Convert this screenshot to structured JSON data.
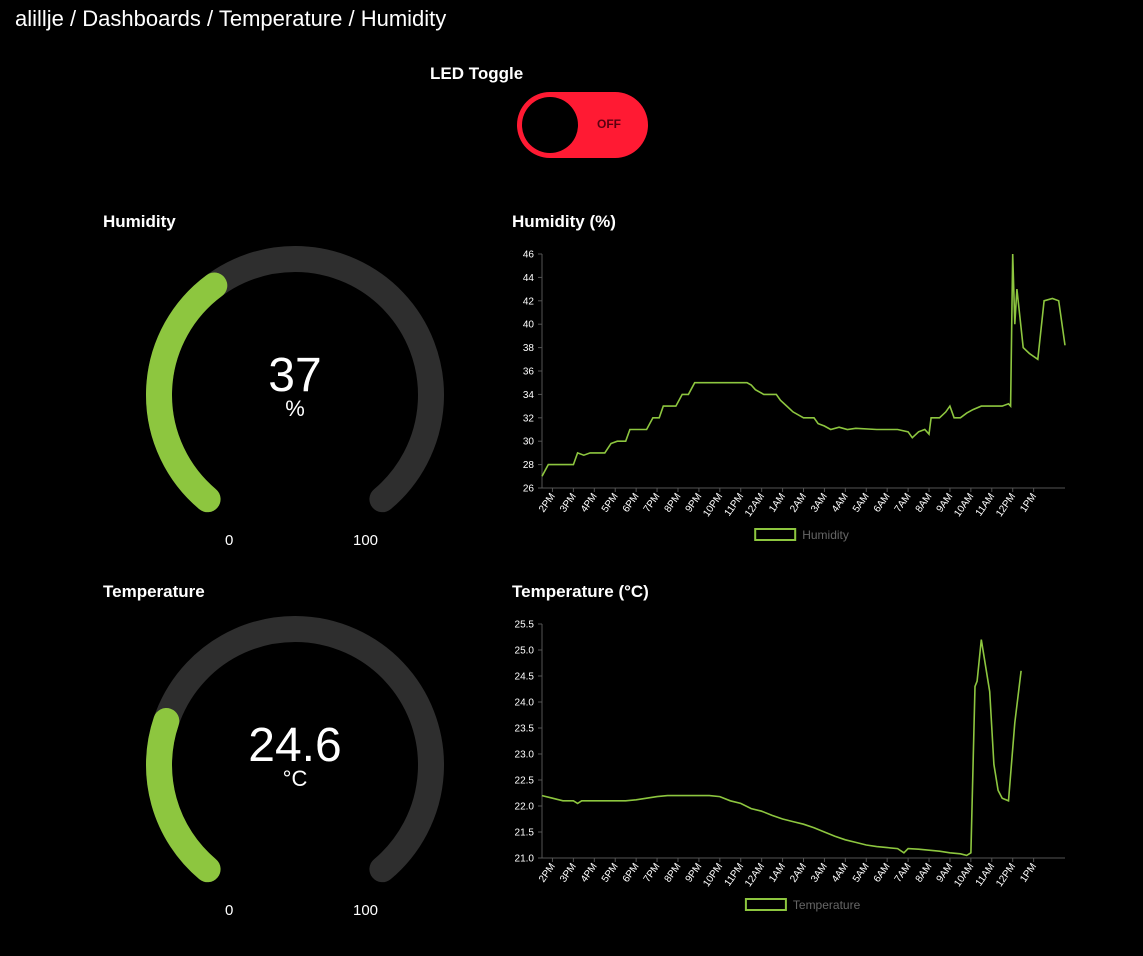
{
  "breadcrumb": {
    "user": "alillje",
    "sep": " / ",
    "dashboards": "Dashboards",
    "dashboard": "Temperature / Humidity"
  },
  "led": {
    "title": "LED Toggle",
    "state_label": "OFF",
    "state": false,
    "color": "#ff1a33"
  },
  "colors": {
    "accent": "#8dc63f",
    "track": "#2e2e2e",
    "background": "#000000"
  },
  "humidity_gauge": {
    "title": "Humidity",
    "value": "37",
    "unit": "%",
    "min": "0",
    "max": "100",
    "level": 0.37
  },
  "temperature_gauge": {
    "title": "Temperature",
    "value": "24.6",
    "unit": "°C",
    "min": "0",
    "max": "100",
    "level": 0.246
  },
  "chart_data": [
    {
      "type": "line",
      "title": "Humidity (%)",
      "x_ticks": [
        "2PM",
        "3PM",
        "4PM",
        "5PM",
        "6PM",
        "7PM",
        "8PM",
        "9PM",
        "10PM",
        "11PM",
        "12AM",
        "1AM",
        "2AM",
        "3AM",
        "4AM",
        "5AM",
        "6AM",
        "7AM",
        "8AM",
        "9AM",
        "10AM",
        "11AM",
        "12PM",
        "1PM"
      ],
      "y_ticks": [
        "26",
        "28",
        "30",
        "32",
        "34",
        "36",
        "38",
        "40",
        "42",
        "44",
        "46"
      ],
      "ylim": [
        26,
        46
      ],
      "legend": "Humidity",
      "legend_position": "bottom",
      "color": "#8dc63f",
      "series": [
        {
          "name": "Humidity",
          "points": [
            [
              0.0,
              27.0
            ],
            [
              0.3,
              28.0
            ],
            [
              1.0,
              28.0
            ],
            [
              1.5,
              28.0
            ],
            [
              1.7,
              29.0
            ],
            [
              2.0,
              28.8
            ],
            [
              2.3,
              29.0
            ],
            [
              3.0,
              29.0
            ],
            [
              3.3,
              29.8
            ],
            [
              3.6,
              30.0
            ],
            [
              4.0,
              30.0
            ],
            [
              4.2,
              31.0
            ],
            [
              5.0,
              31.0
            ],
            [
              5.3,
              32.0
            ],
            [
              5.6,
              32.0
            ],
            [
              5.8,
              33.0
            ],
            [
              6.4,
              33.0
            ],
            [
              6.7,
              34.0
            ],
            [
              7.0,
              34.0
            ],
            [
              7.3,
              35.0
            ],
            [
              8.0,
              35.0
            ],
            [
              9.0,
              35.0
            ],
            [
              9.8,
              35.0
            ],
            [
              10.0,
              34.8
            ],
            [
              10.2,
              34.4
            ],
            [
              10.4,
              34.2
            ],
            [
              10.6,
              34.0
            ],
            [
              11.2,
              34.0
            ],
            [
              11.4,
              33.5
            ],
            [
              11.7,
              33.0
            ],
            [
              12.0,
              32.5
            ],
            [
              12.5,
              32.0
            ],
            [
              13.0,
              32.0
            ],
            [
              13.2,
              31.5
            ],
            [
              13.5,
              31.3
            ],
            [
              13.8,
              31.0
            ],
            [
              14.2,
              31.2
            ],
            [
              14.6,
              31.0
            ],
            [
              15.0,
              31.1
            ],
            [
              16.0,
              31.0
            ],
            [
              17.0,
              31.0
            ],
            [
              17.5,
              30.8
            ],
            [
              17.7,
              30.3
            ],
            [
              18.0,
              30.8
            ],
            [
              18.3,
              31.0
            ],
            [
              18.5,
              30.6
            ],
            [
              18.6,
              32.0
            ],
            [
              19.0,
              32.0
            ],
            [
              19.3,
              32.5
            ],
            [
              19.5,
              33.0
            ],
            [
              19.7,
              32.0
            ],
            [
              20.0,
              32.0
            ],
            [
              20.3,
              32.4
            ],
            [
              20.6,
              32.7
            ],
            [
              21.0,
              33.0
            ],
            [
              21.5,
              33.0
            ],
            [
              22.0,
              33.0
            ],
            [
              22.3,
              33.2
            ],
            [
              22.4,
              33.0
            ],
            [
              22.5,
              46.0
            ],
            [
              22.6,
              40.0
            ],
            [
              22.7,
              43.0
            ],
            [
              23.0,
              38.0
            ],
            [
              23.3,
              37.5
            ],
            [
              23.7,
              37.0
            ],
            [
              24.0,
              42.0
            ],
            [
              24.4,
              42.2
            ],
            [
              24.7,
              42.0
            ],
            [
              25.0,
              38.2
            ]
          ]
        }
      ]
    },
    {
      "type": "line",
      "title": "Temperature (°C)",
      "x_ticks": [
        "2PM",
        "3PM",
        "4PM",
        "5PM",
        "6PM",
        "7PM",
        "8PM",
        "9PM",
        "10PM",
        "11PM",
        "12AM",
        "1AM",
        "2AM",
        "3AM",
        "4AM",
        "5AM",
        "6AM",
        "7AM",
        "8AM",
        "9AM",
        "10AM",
        "11AM",
        "12PM",
        "1PM"
      ],
      "y_ticks": [
        "21.0",
        "21.5",
        "22.0",
        "22.5",
        "23.0",
        "23.5",
        "24.0",
        "24.5",
        "25.0",
        "25.5"
      ],
      "ylim": [
        21.0,
        25.5
      ],
      "legend": "Temperature",
      "legend_position": "bottom",
      "color": "#8dc63f",
      "series": [
        {
          "name": "Temperature",
          "points": [
            [
              0.0,
              22.2
            ],
            [
              0.5,
              22.15
            ],
            [
              1.0,
              22.1
            ],
            [
              1.5,
              22.1
            ],
            [
              1.7,
              22.05
            ],
            [
              1.9,
              22.1
            ],
            [
              2.5,
              22.1
            ],
            [
              3.0,
              22.1
            ],
            [
              4.0,
              22.1
            ],
            [
              4.5,
              22.12
            ],
            [
              5.0,
              22.15
            ],
            [
              5.5,
              22.18
            ],
            [
              6.0,
              22.2
            ],
            [
              7.0,
              22.2
            ],
            [
              8.0,
              22.2
            ],
            [
              8.5,
              22.18
            ],
            [
              9.0,
              22.1
            ],
            [
              9.5,
              22.05
            ],
            [
              10.0,
              21.95
            ],
            [
              10.5,
              21.9
            ],
            [
              11.0,
              21.82
            ],
            [
              11.5,
              21.75
            ],
            [
              12.0,
              21.7
            ],
            [
              12.5,
              21.65
            ],
            [
              13.0,
              21.58
            ],
            [
              13.5,
              21.5
            ],
            [
              14.0,
              21.42
            ],
            [
              14.5,
              21.35
            ],
            [
              15.0,
              21.3
            ],
            [
              15.5,
              21.25
            ],
            [
              16.0,
              21.22
            ],
            [
              16.5,
              21.2
            ],
            [
              17.0,
              21.18
            ],
            [
              17.3,
              21.1
            ],
            [
              17.5,
              21.18
            ],
            [
              18.0,
              21.17
            ],
            [
              18.5,
              21.15
            ],
            [
              19.0,
              21.13
            ],
            [
              19.5,
              21.1
            ],
            [
              20.0,
              21.08
            ],
            [
              20.3,
              21.05
            ],
            [
              20.5,
              21.1
            ],
            [
              20.7,
              24.3
            ],
            [
              20.8,
              24.4
            ],
            [
              21.0,
              25.2
            ],
            [
              21.4,
              24.2
            ],
            [
              21.6,
              22.8
            ],
            [
              21.8,
              22.3
            ],
            [
              22.0,
              22.15
            ],
            [
              22.3,
              22.1
            ],
            [
              22.6,
              23.6
            ],
            [
              22.9,
              24.6
            ]
          ]
        }
      ]
    }
  ]
}
